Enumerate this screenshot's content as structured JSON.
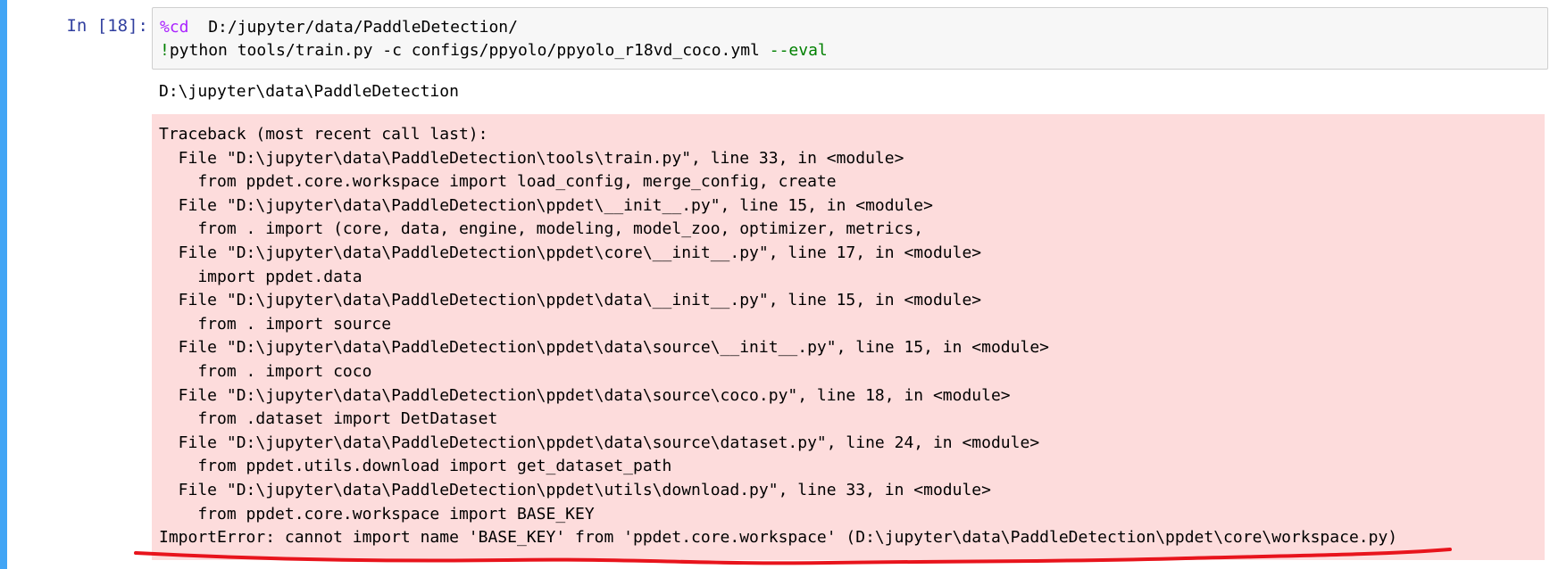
{
  "cell": {
    "prompt": "In  [18]:",
    "input": {
      "line1_magic": "%cd",
      "line1_arg": "  D:/jupyter/data/PaddleDetection/",
      "line2_bang": "!",
      "line2_cmd": "python tools/train.py -c configs/ppyolo/ppyolo_r18vd_coco.yml ",
      "line2_flag": "--eval"
    },
    "stdout": "D:\\jupyter\\data\\PaddleDetection",
    "traceback": [
      "Traceback (most recent call last):",
      "  File \"D:\\jupyter\\data\\PaddleDetection\\tools\\train.py\", line 33, in <module>",
      "    from ppdet.core.workspace import load_config, merge_config, create",
      "  File \"D:\\jupyter\\data\\PaddleDetection\\ppdet\\__init__.py\", line 15, in <module>",
      "    from . import (core, data, engine, modeling, model_zoo, optimizer, metrics,",
      "  File \"D:\\jupyter\\data\\PaddleDetection\\ppdet\\core\\__init__.py\", line 17, in <module>",
      "    import ppdet.data",
      "  File \"D:\\jupyter\\data\\PaddleDetection\\ppdet\\data\\__init__.py\", line 15, in <module>",
      "    from . import source",
      "  File \"D:\\jupyter\\data\\PaddleDetection\\ppdet\\data\\source\\__init__.py\", line 15, in <module>",
      "    from . import coco",
      "  File \"D:\\jupyter\\data\\PaddleDetection\\ppdet\\data\\source\\coco.py\", line 18, in <module>",
      "    from .dataset import DetDataset",
      "  File \"D:\\jupyter\\data\\PaddleDetection\\ppdet\\data\\source\\dataset.py\", line 24, in <module>",
      "    from ppdet.utils.download import get_dataset_path",
      "  File \"D:\\jupyter\\data\\PaddleDetection\\ppdet\\utils\\download.py\", line 33, in <module>",
      "    from ppdet.core.workspace import BASE_KEY",
      "ImportError: cannot import name 'BASE_KEY' from 'ppdet.core.workspace' (D:\\jupyter\\data\\PaddleDetection\\ppdet\\core\\workspace.py)"
    ]
  },
  "colors": {
    "cell_selected_border": "#42a5f5",
    "prompt": "#303f9f",
    "magic": "#aa22ff",
    "shell_flag": "#008000",
    "stderr_background": "#fddcdc",
    "annotation_underline": "#e8141c"
  }
}
